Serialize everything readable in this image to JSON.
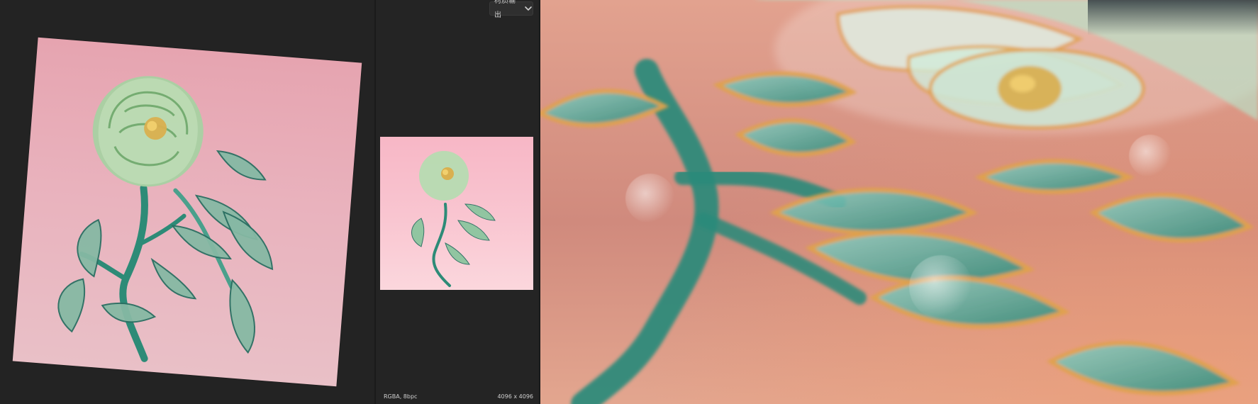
{
  "middle_panel": {
    "dropdown_label": "材质输出",
    "format_label": "RGBA, 8bpc",
    "resolution_label": "4096 x 4096"
  },
  "icons": {
    "dropdown": "chevron-down-icon"
  },
  "colors": {
    "background": "#1f1f1f",
    "panel": "#242424",
    "pink": "#e9b2bd",
    "green": "#8cc59f",
    "teal": "#2f8a7a",
    "gold": "#d9b04f"
  }
}
